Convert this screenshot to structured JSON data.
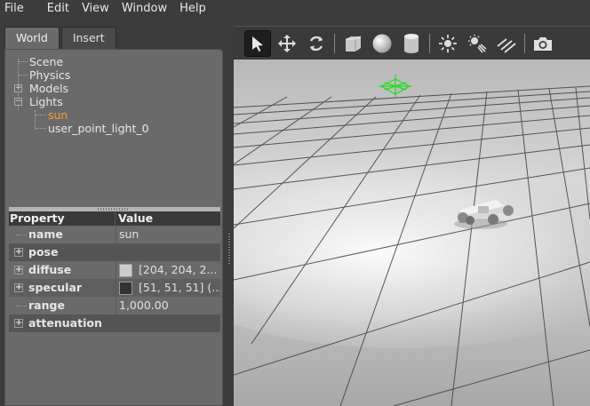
{
  "menu": [
    "File",
    "Edit",
    "View",
    "Window",
    "Help"
  ],
  "tabs": {
    "world": "World",
    "insert": "Insert"
  },
  "tree": {
    "scene": "Scene",
    "physics": "Physics",
    "models": "Models",
    "lights": "Lights",
    "sun": "sun",
    "point_light": "user_point_light_0"
  },
  "properties": {
    "header_property": "Property",
    "header_value": "Value",
    "rows": [
      {
        "name": "name",
        "value": "sun"
      },
      {
        "name": "pose",
        "value": ""
      },
      {
        "name": "diffuse",
        "value": "[204, 204, 2...",
        "swatch": "#cccccc"
      },
      {
        "name": "specular",
        "value": "[51, 51, 51] (...",
        "swatch": "#333333"
      },
      {
        "name": "range",
        "value": "1,000.00"
      },
      {
        "name": "attenuation",
        "value": ""
      }
    ]
  },
  "toolbar": [
    "select-arrow-icon",
    "translate-icon",
    "rotate-icon",
    "box-icon",
    "sphere-icon",
    "cylinder-icon",
    "point-light-icon",
    "spot-light-icon",
    "directional-light-icon",
    "camera-icon"
  ],
  "colors": {
    "selected_text": "#f39c3c",
    "light_marker": "#22dd22"
  }
}
